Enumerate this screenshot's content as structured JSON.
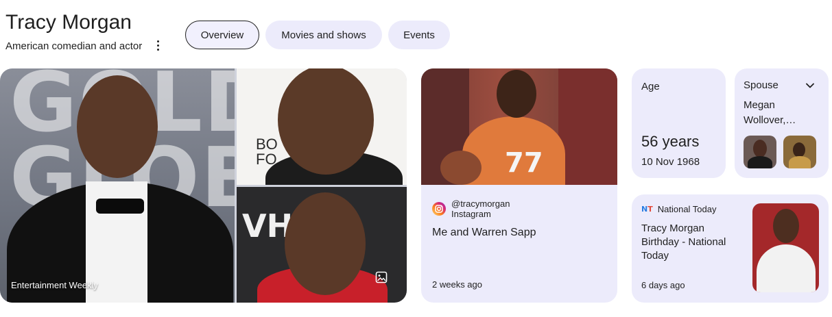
{
  "header": {
    "title": "Tracy Morgan",
    "subtitle": "American comedian and actor",
    "more_icon": "more-vert-icon"
  },
  "tabs": [
    {
      "label": "Overview",
      "active": true
    },
    {
      "label": "Movies and shows",
      "active": false
    },
    {
      "label": "Events",
      "active": false
    }
  ],
  "images": {
    "main_source": "Entertainment Weekly",
    "background_letters": "GOLDEN GLOB",
    "tr_letters": "BO FO",
    "br_letters": "VH",
    "more_images_icon": "image-icon"
  },
  "video": {
    "account": "@tracymorgan",
    "platform": "Instagram",
    "caption": "Me and Warren Sapp",
    "time": "2 weeks ago",
    "jersey_number": "77",
    "icon": "instagram-icon"
  },
  "age": {
    "label": "Age",
    "value": "56 years",
    "birth_date": "10 Nov 1968"
  },
  "spouse": {
    "label": "Spouse",
    "name": "Megan Wollover,…",
    "expand_icon": "chevron-down-icon"
  },
  "news": {
    "source_logo": "NT",
    "source": "National Today",
    "title": "Tracy Morgan Birthday - National Today",
    "time": "6 days ago"
  },
  "colors": {
    "card_bg": "#ecebfb",
    "text": "#1f1f1f",
    "news_image_bg": "#a4282a"
  }
}
